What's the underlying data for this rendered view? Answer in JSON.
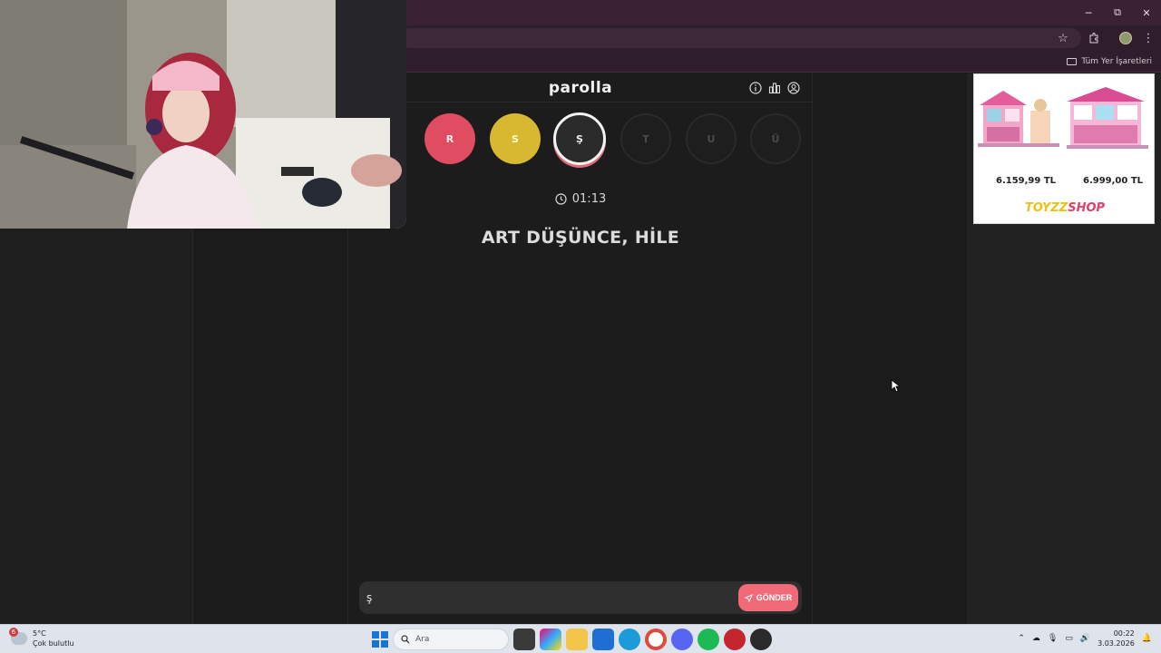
{
  "browser": {
    "bookmarks_folder": "Tüm Yer İşaretleri",
    "window_minimize": "─",
    "window_restore": "⧉",
    "window_close": "✕"
  },
  "game": {
    "logo": "parolla",
    "letters": [
      {
        "label": "R",
        "state": "correct"
      },
      {
        "label": "S",
        "state": "passed"
      },
      {
        "label": "Ş",
        "state": "current"
      },
      {
        "label": "T",
        "state": "pending"
      },
      {
        "label": "U",
        "state": "pending"
      },
      {
        "label": "Ü",
        "state": "pending"
      }
    ],
    "timer": "01:13",
    "clue": "ART DÜŞÜNCE, HİLE",
    "answer_value": "ş",
    "send_label": "GÖNDER"
  },
  "ad": {
    "price_1": "6.159,99 TL",
    "price_2": "6.999,00 TL",
    "logo_part_1": "TOYZZ",
    "logo_part_2": "SHOP"
  },
  "taskbar": {
    "weather_badge": "6",
    "temperature": "5°C",
    "weather_desc": "Çok bulutlu",
    "search_label": "Ara",
    "time": "00:22",
    "date": "3.03.2026"
  }
}
